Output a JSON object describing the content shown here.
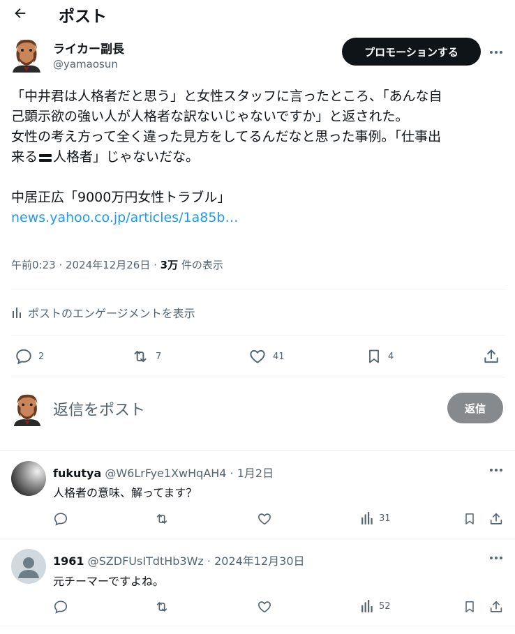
{
  "header": {
    "title": "ポスト"
  },
  "author": {
    "name": "ライカー副長",
    "handle": "@yamaosun"
  },
  "promote_label": "プロモーションする",
  "tweet": {
    "line1": "「中井君は人格者だと思う」と女性スタッフに言ったところ、「あんな自",
    "line2": "己顕示欲の強い人が人格者な訳ないじゃないですか」と返された。",
    "line3": "女性の考え方って全く違った見方をしてるんだなと思った事例。「仕事出",
    "line4a": "来る",
    "line4b": "人格者」じゃないだな。",
    "line5": "中居正広「9000万円女性トラブル」",
    "link": "news.yahoo.co.jp/articles/1a85b…"
  },
  "meta": {
    "time": "午前0:23 · 2024年12月26日 · ",
    "views": "3万",
    "views_suffix": " 件の表示"
  },
  "engagement_label": "ポストのエンゲージメントを表示",
  "actions": {
    "replies": "2",
    "reposts": "7",
    "likes": "41",
    "bookmarks": "4"
  },
  "compose": {
    "placeholder": "返信をポスト",
    "button": "返信"
  },
  "replies": [
    {
      "name": "fukutya",
      "handle": "@W6LrFye1XwHqAH4 · 1月2日",
      "text": "人格者の意味、解ってます？",
      "views": "31"
    },
    {
      "name": "1961",
      "handle": "@SZDFUsITdtHb3Wz · 2024年12月30日",
      "text": "元チーマーですよね。",
      "views": "52"
    }
  ],
  "colors": {
    "link": "#1d9bf0",
    "muted": "#536471",
    "text": "#0f1419"
  }
}
